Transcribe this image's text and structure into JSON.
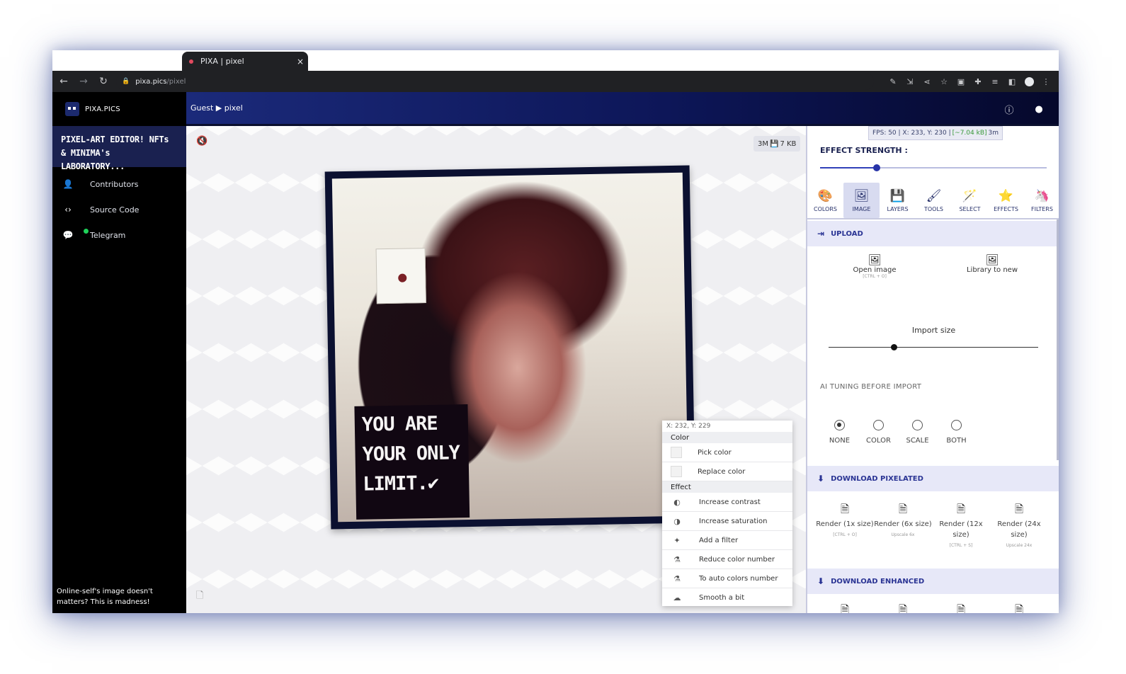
{
  "browser": {
    "tab_title": "PIXA | pixel",
    "tab_close": "×",
    "url_host": "pixa.pics",
    "url_path": "/pixel"
  },
  "sidebar": {
    "brand": "PIXA.PICS",
    "tagline": "PIXEL-ART EDITOR! NFTs & MINIMA's LABORATORY...",
    "items": [
      {
        "label": "Contributors",
        "icon": "person-icon"
      },
      {
        "label": "Source Code",
        "icon": "code-icon"
      },
      {
        "label": "Telegram",
        "icon": "chat-icon"
      }
    ],
    "footer": "Online-self's image doesn't matters? This is madness!"
  },
  "topbar": {
    "breadcrumb": "Guest ▶ pixel"
  },
  "canvas": {
    "size_badge_left": "3M",
    "size_badge_right": "7 KB",
    "quote_lines": [
      "YOU ARE",
      "YOUR ONLY",
      "LIMIT.✔"
    ]
  },
  "context_menu": {
    "coords": "X: 232, Y: 229",
    "sections": [
      {
        "title": "Color",
        "items": [
          {
            "label": "Pick color",
            "icon": "swatch"
          },
          {
            "label": "Replace color",
            "icon": "swatch"
          }
        ]
      },
      {
        "title": "Effect",
        "items": [
          {
            "label": "Increase contrast",
            "icon": "contrast-icon"
          },
          {
            "label": "Increase saturation",
            "icon": "saturation-icon"
          },
          {
            "label": "Add a filter",
            "icon": "sparkle-icon"
          },
          {
            "label": "Reduce color number",
            "icon": "flask-icon"
          },
          {
            "label": "To auto colors number",
            "icon": "flask-icon"
          },
          {
            "label": "Smooth a bit",
            "icon": "cloud-icon"
          }
        ]
      }
    ]
  },
  "panel": {
    "fps_text": "FPS: 50 | X: 233, Y: 230 |",
    "fps_mem": "[~7.04 kB]",
    "fps_tail": "3m",
    "effect_strength_label": "EFFECT STRENGTH :",
    "effect_strength_value": 0.25,
    "tabs": [
      {
        "label": "COLORS",
        "icon": "palette-icon",
        "glyph": "🎨",
        "active": false
      },
      {
        "label": "IMAGE",
        "icon": "image-icon",
        "glyph": "🖼",
        "active": true
      },
      {
        "label": "LAYERS",
        "icon": "layers-icon",
        "glyph": "💾",
        "active": false
      },
      {
        "label": "TOOLS",
        "icon": "brush-icon",
        "glyph": "🖌",
        "active": false
      },
      {
        "label": "SELECT",
        "icon": "wand-icon",
        "glyph": "🪄",
        "active": false
      },
      {
        "label": "EFFECTS",
        "icon": "star-icon",
        "glyph": "⭐",
        "active": false
      },
      {
        "label": "FILTERS",
        "icon": "unicorn-icon",
        "glyph": "🦄",
        "active": false
      }
    ],
    "upload_header": "UPLOAD",
    "open_image_label": "Open image",
    "open_image_hint": "[CTRL + O]",
    "library_label": "Library to new",
    "import_size_label": "Import size",
    "import_size_value": 0.31,
    "ai_tuning_label": "AI TUNING BEFORE IMPORT",
    "ai_options": [
      {
        "label": "NONE",
        "checked": true
      },
      {
        "label": "COLOR",
        "checked": false
      },
      {
        "label": "SCALE",
        "checked": false
      },
      {
        "label": "BOTH",
        "checked": false
      }
    ],
    "download_pixelated_header": "DOWNLOAD PIXELATED",
    "renders": [
      {
        "label": "Render (1x size)",
        "hint": "[CTRL + O]"
      },
      {
        "label": "Render (6x size)",
        "hint": "Upscale 6x"
      },
      {
        "label": "Render (12x size)",
        "hint": "[CTRL + S]"
      },
      {
        "label": "Render (24x size)",
        "hint": "Upscale 24x"
      }
    ],
    "download_enhanced_header": "DOWNLOAD ENHANCED"
  }
}
